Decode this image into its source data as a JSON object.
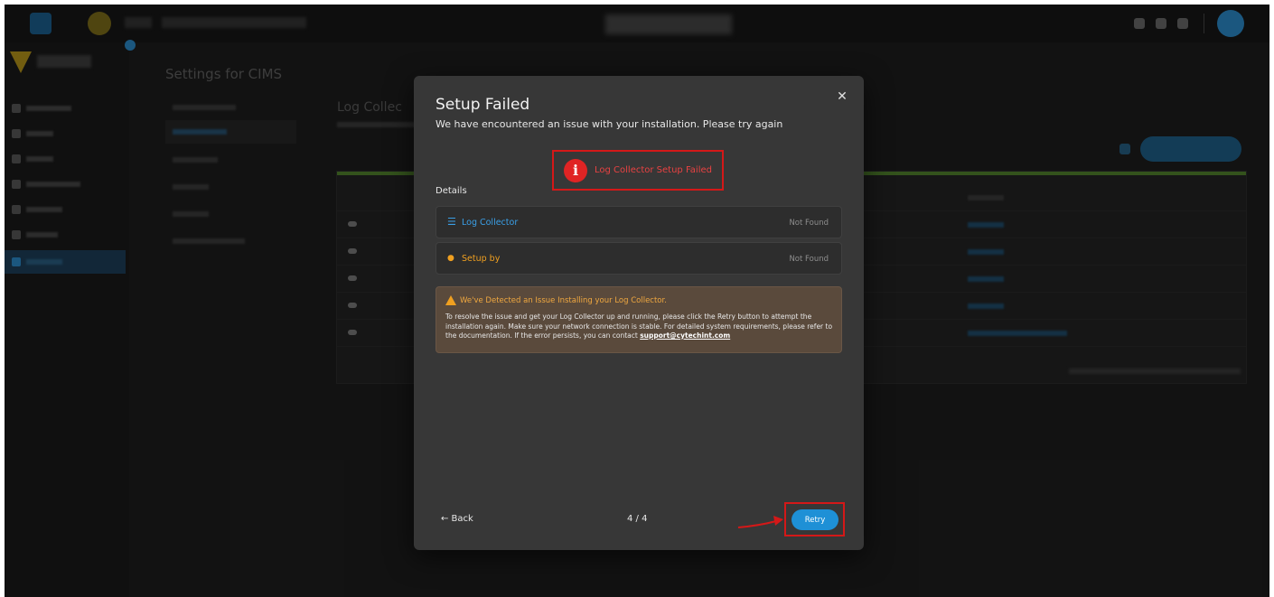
{
  "modal": {
    "title": "Setup Failed",
    "subtitle": "We have encountered an issue with your installation. Please try again",
    "close_glyph": "✕",
    "status_banner": {
      "icon": "info-icon",
      "icon_glyph": "i",
      "text": "Log Collector Setup Failed"
    },
    "details_label": "Details",
    "details": [
      {
        "icon": "list-icon",
        "icon_glyph": "☰",
        "label": "Log Collector",
        "status": "Not Found",
        "color": "#3aa0e8"
      },
      {
        "icon": "user-icon",
        "icon_glyph": "●",
        "label": "Setup by",
        "status": "Not Found",
        "color": "#f0a020"
      }
    ],
    "warning": {
      "title": "We've Detected an Issue Installing your Log Collector.",
      "body": "To resolve the issue and get your Log Collector up and running, please click the Retry button to attempt the installation again. Make sure your network connection is stable. For detailed system requirements, please refer to the documentation. If the error persists, you can contact ",
      "link": "support@cytechint.com"
    },
    "back_label": "← Back",
    "step": "4 / 4",
    "retry_label": "Retry"
  },
  "background": {
    "settings_title": "Settings for CIMS",
    "section_title": "Log Collec"
  },
  "colors": {
    "accent": "#1e90d6",
    "error": "#e02424",
    "warning": "#f0a020",
    "modal_bg": "#373737"
  }
}
